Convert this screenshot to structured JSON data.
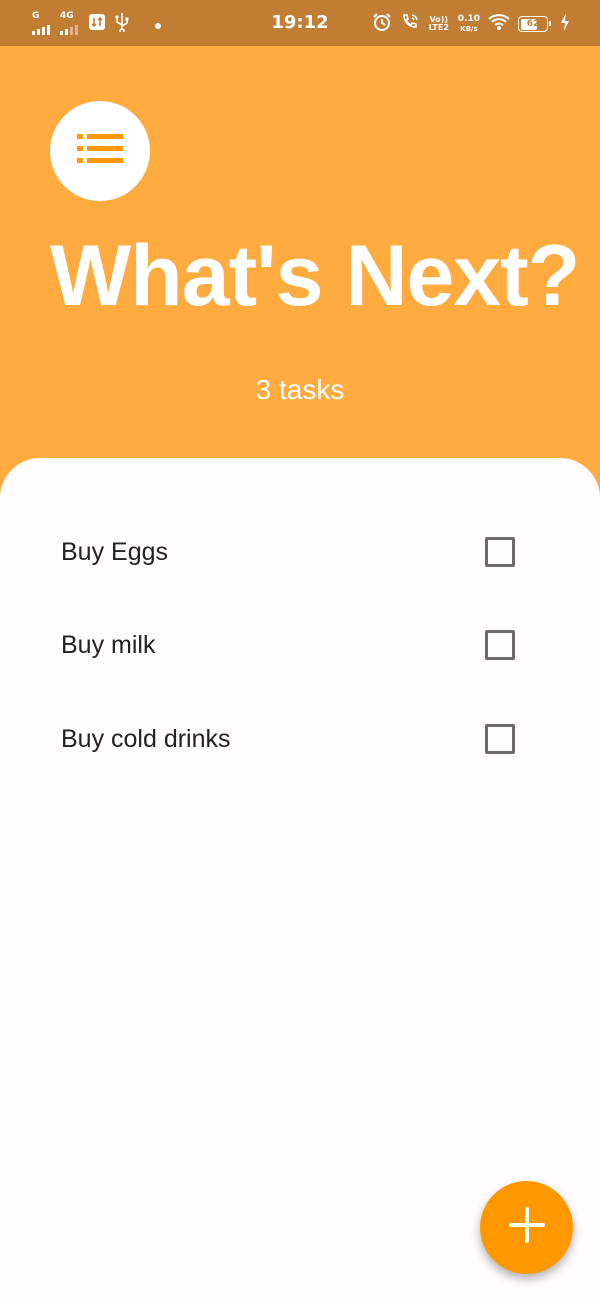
{
  "status_bar": {
    "network_type_sim1": "G",
    "network_type_sim2": "4G",
    "time": "19:12",
    "volte_label": "Vo)) LTE2",
    "speed_value": "0.10",
    "speed_unit": "KB/s",
    "battery_level": "62",
    "icons": [
      "signal-icon",
      "data-transfer-icon",
      "usb-icon",
      "notification-dot-icon",
      "alarm-icon",
      "wifi-calling-icon",
      "volte-icon",
      "wifi-icon",
      "battery-icon",
      "charging-icon"
    ]
  },
  "header": {
    "title": "What's Next?",
    "task_count": "3 tasks",
    "avatar_icon": "list-icon"
  },
  "tasks": [
    {
      "label": "Buy Eggs",
      "checked": false
    },
    {
      "label": "Buy milk",
      "checked": false
    },
    {
      "label": "Buy cold drinks",
      "checked": false
    }
  ],
  "fab": {
    "icon": "add-icon"
  },
  "colors": {
    "status_bar": "#c17d33",
    "header_bg": "#ffab40",
    "accent": "#ff9800",
    "card_bg": "#fffdfd",
    "checkbox_border": "#6b6b6b"
  }
}
